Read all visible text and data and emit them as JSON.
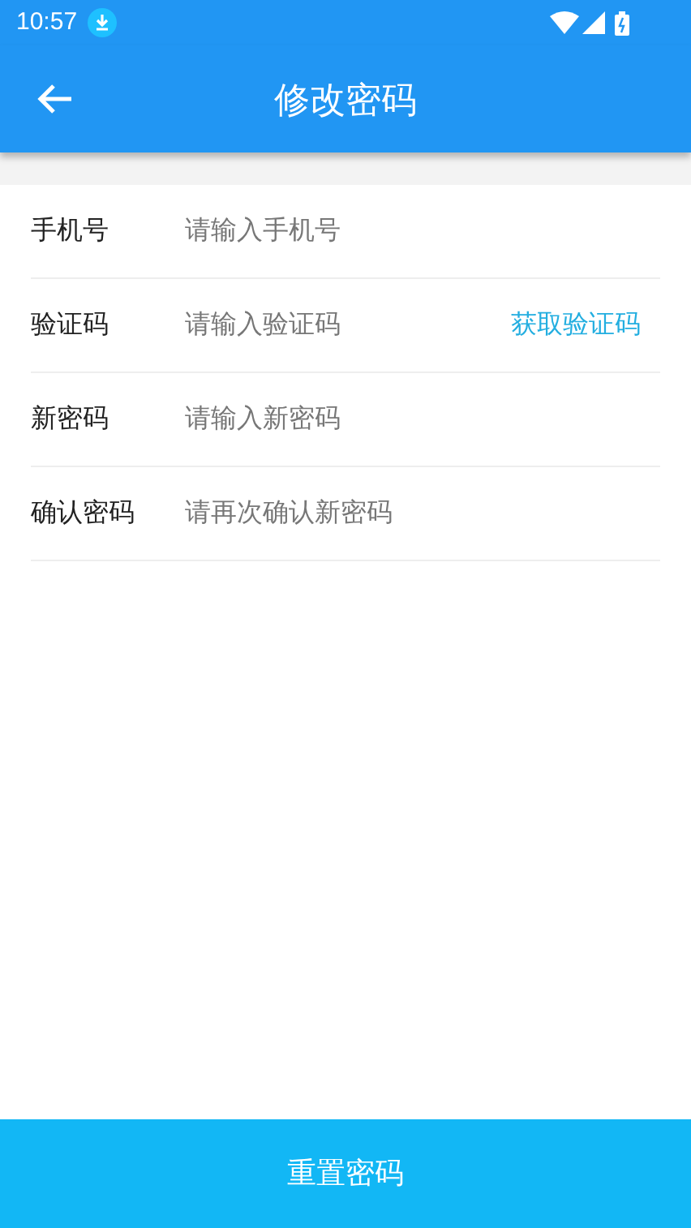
{
  "status_bar": {
    "time": "10:57"
  },
  "toolbar": {
    "title": "修改密码"
  },
  "fields": [
    {
      "label": "手机号",
      "placeholder": "请输入手机号"
    },
    {
      "label": "验证码",
      "placeholder": "请输入验证码",
      "action": "获取验证码"
    },
    {
      "label": "新密码",
      "placeholder": "请输入新密码"
    },
    {
      "label": "确认密码",
      "placeholder": "请再次确认新密码"
    }
  ],
  "submit_button": "重置密码"
}
